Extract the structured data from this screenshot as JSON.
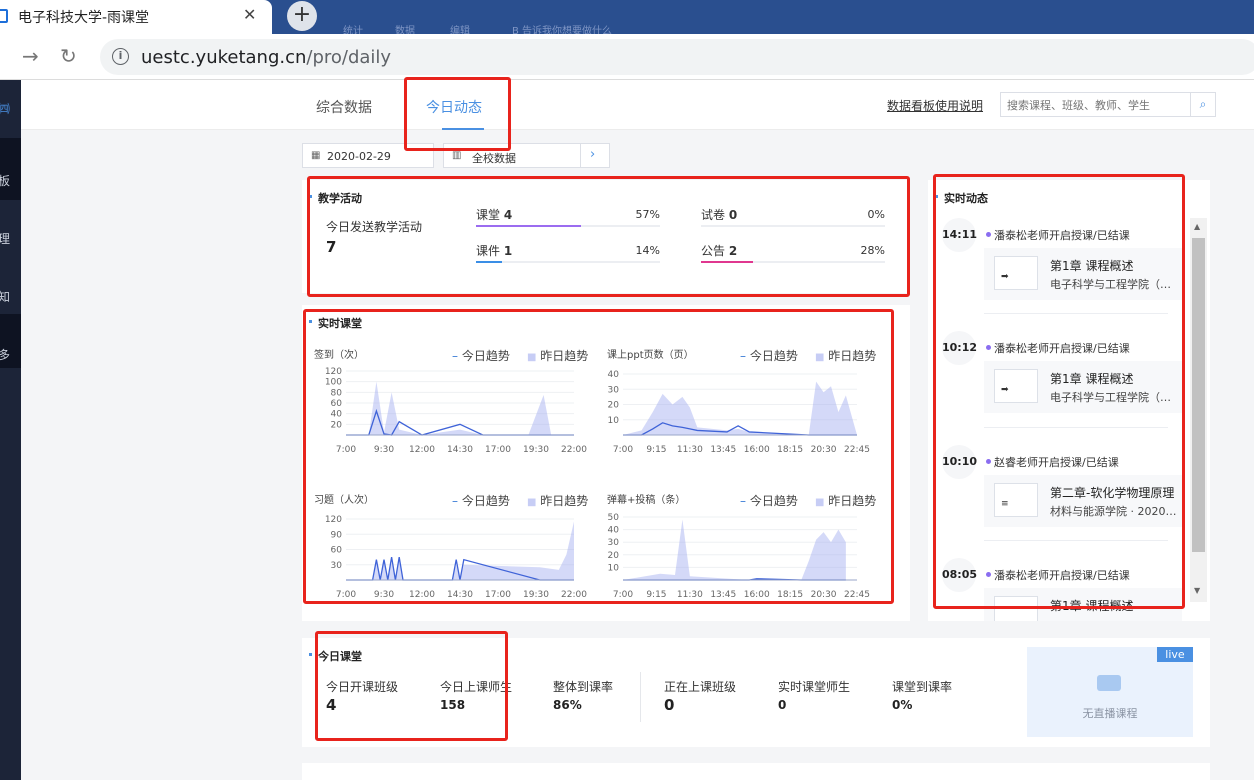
{
  "browser": {
    "tab_title": "电子科技大学-雨课堂",
    "close": "✕",
    "new_tab": "+",
    "url_host": "uestc.yuketang.cn",
    "url_path": "/pro/daily",
    "ghost_tabs": [
      "统计",
      "数据",
      "编辑",
      "B 告诉我你想要做什么"
    ]
  },
  "rail": {
    "items": [
      "板",
      "理",
      "知",
      "多"
    ]
  },
  "nav": {
    "tabs": [
      "综合数据",
      "今日动态"
    ],
    "active": "今日动态",
    "help_link": "数据看板使用说明",
    "search_placeholder": "搜索课程、班级、教师、学生"
  },
  "filters": {
    "date": "2020-02-29",
    "scope": "全校数据"
  },
  "teaching": {
    "title": "教学活动",
    "sent_label": "今日发送教学活动",
    "sent_value": "7",
    "items": [
      {
        "name": "课堂",
        "count": "4",
        "pct": "57%",
        "ratio": 0.57,
        "color": "#9b6cf0"
      },
      {
        "name": "课件",
        "count": "1",
        "pct": "14%",
        "ratio": 0.14,
        "color": "#3a8ee6"
      },
      {
        "name": "试卷",
        "count": "0",
        "pct": "0%",
        "ratio": 0,
        "color": "#3a8ee6"
      },
      {
        "name": "公告",
        "count": "2",
        "pct": "28%",
        "ratio": 0.28,
        "color": "#e0378f"
      }
    ]
  },
  "realtime_class": {
    "title": "实时课堂",
    "legend_today": "今日趋势",
    "legend_yesterday": "昨日趋势"
  },
  "chart_data": [
    {
      "type": "area",
      "title": "签到（次）",
      "x_ticks": [
        "7:00",
        "9:30",
        "12:00",
        "14:30",
        "17:00",
        "19:30",
        "22:00"
      ],
      "y_ticks": [
        120,
        100,
        80,
        60,
        40,
        20
      ],
      "ylim": [
        0,
        120
      ],
      "x": [
        "7:00",
        "8:30",
        "9:00",
        "9:30",
        "10:00",
        "10:30",
        "12:00",
        "14:30",
        "16:00",
        "19:00",
        "20:00",
        "20:30",
        "22:00"
      ],
      "series": [
        {
          "name": "今日趋势",
          "values": [
            0,
            0,
            45,
            2,
            0,
            25,
            0,
            20,
            0,
            0,
            0,
            0,
            0
          ]
        },
        {
          "name": "昨日趋势",
          "values": [
            0,
            0,
            100,
            5,
            80,
            10,
            0,
            10,
            0,
            0,
            75,
            0,
            0
          ]
        }
      ]
    },
    {
      "type": "area",
      "title": "课上ppt页数（页）",
      "x_ticks": [
        "7:00",
        "9:15",
        "11:30",
        "13:45",
        "16:00",
        "18:15",
        "20:30",
        "22:45"
      ],
      "y_ticks": [
        40,
        30,
        20,
        10
      ],
      "ylim": [
        0,
        40
      ],
      "x": [
        "7:00",
        "8:15",
        "9:00",
        "9:40",
        "10:20",
        "11:00",
        "11:30",
        "12:00",
        "14:00",
        "14:45",
        "15:30",
        "19:30",
        "20:00",
        "20:30",
        "21:00",
        "21:30",
        "22:00",
        "22:45"
      ],
      "series": [
        {
          "name": "今日趋势",
          "values": [
            0,
            0,
            4,
            8,
            6,
            5,
            4,
            3,
            2,
            6,
            2,
            0,
            0,
            0,
            0,
            0,
            0,
            0
          ]
        },
        {
          "name": "昨日趋势",
          "values": [
            0,
            3,
            15,
            27,
            20,
            25,
            18,
            5,
            3,
            4,
            2,
            0,
            35,
            28,
            32,
            15,
            26,
            0
          ]
        }
      ]
    },
    {
      "type": "area",
      "title": "习题（人次）",
      "x_ticks": [
        "7:00",
        "9:30",
        "12:00",
        "14:30",
        "17:00",
        "19:30",
        "22:00"
      ],
      "y_ticks": [
        120,
        90,
        60,
        30
      ],
      "ylim": [
        0,
        120
      ],
      "x": [
        "7:00",
        "8:45",
        "9:00",
        "9:15",
        "9:30",
        "9:45",
        "10:00",
        "10:15",
        "10:30",
        "10:45",
        "11:00",
        "14:00",
        "14:15",
        "14:30",
        "14:45",
        "19:45",
        "21:00",
        "21:30",
        "22:00"
      ],
      "series": [
        {
          "name": "今日趋势",
          "values": [
            0,
            0,
            40,
            0,
            40,
            0,
            45,
            0,
            45,
            0,
            0,
            0,
            40,
            0,
            40,
            0,
            0,
            0,
            0
          ]
        },
        {
          "name": "昨日趋势",
          "values": [
            0,
            0,
            35,
            0,
            40,
            0,
            35,
            0,
            38,
            0,
            0,
            0,
            30,
            0,
            30,
            25,
            20,
            50,
            115
          ]
        }
      ]
    },
    {
      "type": "area",
      "title": "弹幕+投稿（条）",
      "x_ticks": [
        "7:00",
        "9:15",
        "11:30",
        "13:45",
        "16:00",
        "18:15",
        "20:30",
        "22:45"
      ],
      "y_ticks": [
        50,
        40,
        30,
        20,
        10
      ],
      "ylim": [
        0,
        50
      ],
      "x": [
        "7:00",
        "8:30",
        "9:30",
        "10:30",
        "11:00",
        "11:30",
        "15:30",
        "16:00",
        "19:00",
        "19:30",
        "20:00",
        "20:30",
        "21:00",
        "21:30",
        "22:00"
      ],
      "series": [
        {
          "name": "今日趋势",
          "values": [
            0,
            0,
            0,
            0,
            0,
            0,
            0,
            1,
            0,
            0,
            0,
            0,
            0,
            0,
            0
          ]
        },
        {
          "name": "昨日趋势",
          "values": [
            0,
            3,
            5,
            4,
            48,
            3,
            0,
            0,
            0,
            15,
            32,
            38,
            30,
            40,
            30
          ]
        }
      ]
    }
  ],
  "feed": {
    "title": "实时动态",
    "items": [
      {
        "time": "14:11",
        "msg": "潘泰松老师开启授课/已结课",
        "course": "第1章 课程概述",
        "dept": "电子科学与工程学院（…",
        "thumb": "➡"
      },
      {
        "time": "10:12",
        "msg": "潘泰松老师开启授课/已结课",
        "course": "第1章 课程概述",
        "dept": "电子科学与工程学院（…",
        "thumb": "➡"
      },
      {
        "time": "10:10",
        "msg": "赵睿老师开启授课/已结课",
        "course": "第二章-软化学物理原理",
        "dept": "材料与能源学院 · 2020…",
        "thumb": "≡"
      },
      {
        "time": "08:05",
        "msg": "潘泰松老师开启授课/已结课",
        "course": "第1章 课程概述",
        "dept": "",
        "thumb": ""
      }
    ]
  },
  "today_class": {
    "title": "今日课堂",
    "stats": [
      {
        "label": "今日开课班级",
        "value": "4"
      },
      {
        "label": "今日上课师生",
        "value": "158"
      },
      {
        "label": "整体到课率",
        "value": "86%"
      },
      {
        "label": "正在上课班级",
        "value": "0"
      },
      {
        "label": "实时课堂师生",
        "value": "0"
      },
      {
        "label": "课堂到课率",
        "value": "0%"
      }
    ],
    "live_badge": "live",
    "live_empty": "无直播课程"
  }
}
